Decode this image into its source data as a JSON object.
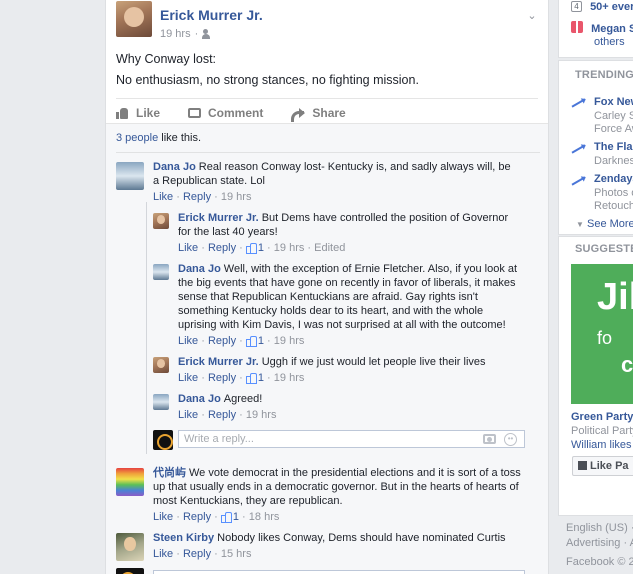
{
  "post": {
    "author": "Erick Murrer Jr.",
    "time": "19 hrs",
    "title_line": "Why Conway lost:",
    "body_line": "No enthusiasm, no strong stances, no fighting mission.",
    "actions": {
      "like": "Like",
      "comment": "Comment",
      "share": "Share"
    },
    "likes_count": "3 people",
    "likes_suffix": " like this."
  },
  "comments": [
    {
      "name": "Dana Jo",
      "text": "Real reason Conway lost- Kentucky is, and sadly always will, be a Republican state. Lol",
      "like": "Like",
      "reply": "Reply",
      "time": "19 hrs"
    }
  ],
  "replies": [
    {
      "name": "Erick Murrer Jr.",
      "text": "But Dems have controlled the position of Governor for the last 40 years!",
      "like": "Like",
      "reply": "Reply",
      "likes": "1",
      "time": "19 hrs",
      "edited": "Edited"
    },
    {
      "name": "Dana Jo",
      "text": "Well, with the exception of Ernie Fletcher. Also, if you look at the big events that have gone on recently in favor of liberals, it makes sense that Republican Kentuckians are afraid. Gay rights isn't something Kentucky holds dear to its heart, and with the whole uprising with Kim Davis, I was not surprised at all with the outcome!",
      "like": "Like",
      "reply": "Reply",
      "likes": "1",
      "time": "19 hrs"
    },
    {
      "name": "Erick Murrer Jr.",
      "text": "Uggh if we just would let people live their lives",
      "like": "Like",
      "reply": "Reply",
      "likes": "1",
      "time": "19 hrs"
    },
    {
      "name": "Dana Jo",
      "text": "Agreed!",
      "like": "Like",
      "reply": "Reply",
      "time": "19 hrs"
    }
  ],
  "reply_box": {
    "placeholder": "Write a reply..."
  },
  "more_comments": [
    {
      "name": "代尚屿",
      "text": "We vote democrat in the presidential elections and it is sort of a toss up that usually ends in a democratic governor. But in the hearts of hearts of most Kentuckians, they are republican.",
      "like": "Like",
      "reply": "Reply",
      "likes": "1",
      "time": "18 hrs"
    },
    {
      "name": "Steen Kirby",
      "text": "Nobody likes Conway, Dems should have nominated Curtis",
      "like": "Like",
      "reply": "Reply",
      "time": "15 hrs"
    }
  ],
  "sidebar": {
    "events_badge": "4",
    "events_text": "50+ ever",
    "birthday_name": "Megan S",
    "birthday_others": "others",
    "trending_header": "TRENDING",
    "trending": [
      {
        "title": "Fox New",
        "sub1": "Carley S",
        "sub2": "Force Aw"
      },
      {
        "title": "The Flas",
        "sub1": "Darkness"
      },
      {
        "title": "Zendaya",
        "sub1": "Photos o",
        "sub2": "Retouchi"
      }
    ],
    "see_more": "See More",
    "suggested_header": "SUGGESTED",
    "ad_big": "Jil",
    "ad_fo": "fo",
    "ad_ci": "c",
    "ad_title": "Green Party",
    "ad_sub": "Political Party",
    "ad_likes": "William likes t",
    "like_page": "Like Pa",
    "footer1": "English (US) ·",
    "footer2": "Advertising · A",
    "footer3": "Facebook © 2"
  }
}
